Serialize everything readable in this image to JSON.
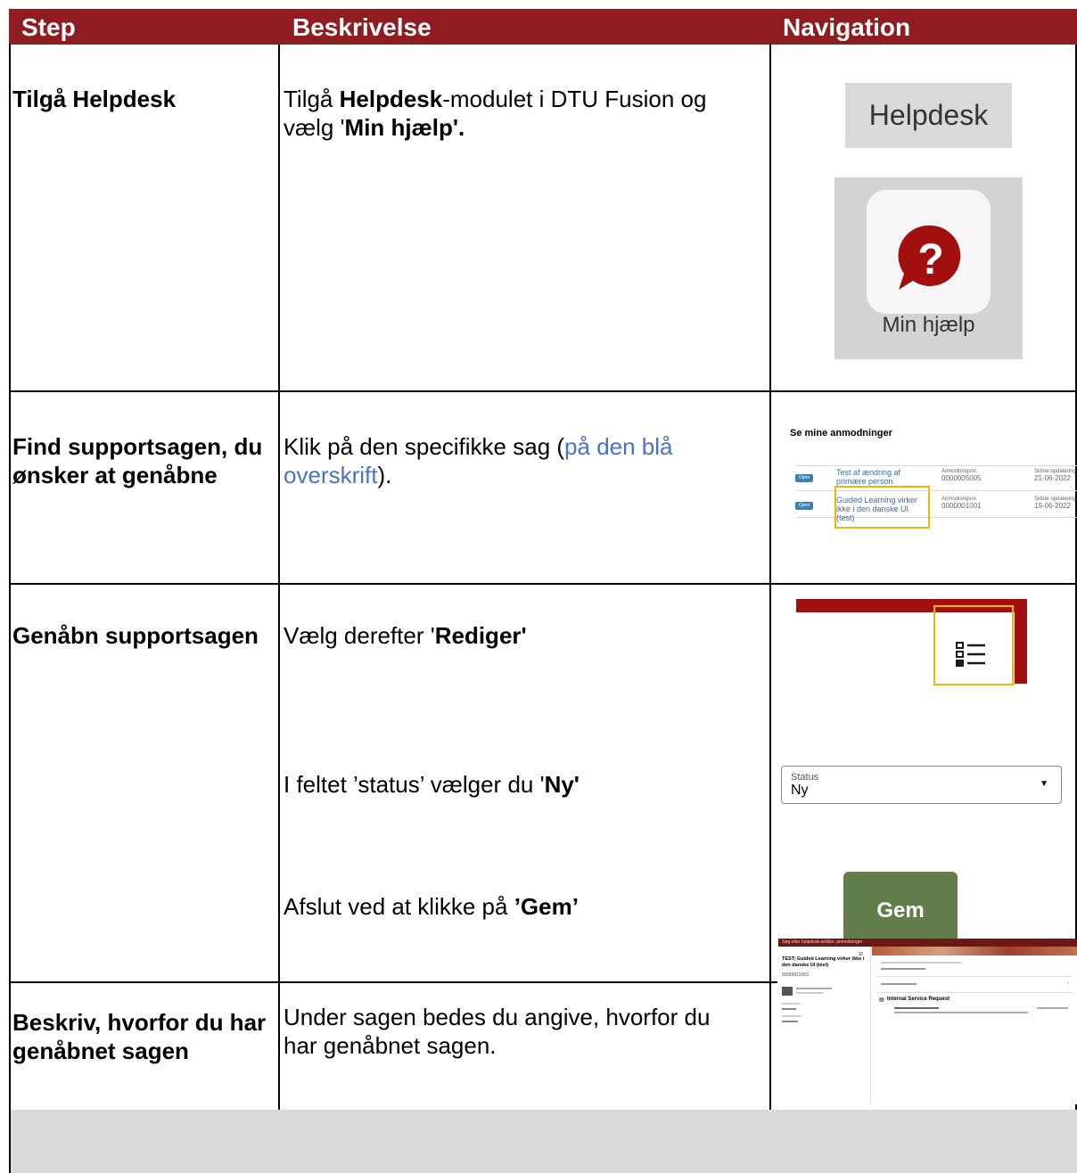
{
  "header": {
    "step": "Step",
    "description": "Beskrivelse",
    "navigation": "Navigation"
  },
  "colors": {
    "header_bg": "#8e1c20",
    "link": "#4a72c4",
    "gem_button": "#627e4b",
    "highlight": "#f2b705"
  },
  "rows": [
    {
      "step": "Tilgå Helpdesk",
      "desc": {
        "p1": "Tilgå ",
        "b1": "Helpdesk",
        "p2": "-modulet i DTU Fusion og vælg '",
        "b2": "Min hjælp'."
      },
      "nav": {
        "helpdesk_label": "Helpdesk",
        "min_hjaelp_label": "Min hjælp"
      }
    },
    {
      "step": "Find supportsagen, du ønsker at genåbne",
      "desc": {
        "p1": "Klik på den specifikke sag (",
        "link": "på den blå overskrift",
        "p2": ")."
      },
      "nav": {
        "title": "Se mine anmodninger",
        "items": [
          {
            "badge": "Open",
            "name": "Test af ændring af primære person",
            "num_label": "Anmodningsnr.",
            "num": "0000005005",
            "date_label": "Sidste opdatering",
            "date": "21-06-2022"
          },
          {
            "badge": "Open",
            "name": "Guided Learning virker ikke i den danske UI (test)",
            "num_label": "Anmodningsnr.",
            "num": "0000001001",
            "date_label": "Sidste opdatering",
            "date": "19-06-2022"
          }
        ]
      }
    },
    {
      "step": "Genåbn supportsagen",
      "desc1": {
        "p1": "Vælg derefter '",
        "b1": "Rediger'"
      },
      "desc2": {
        "p1": "I feltet ’status’ vælger du '",
        "b1": "Ny'"
      },
      "desc3": {
        "p1": "Afslut ved at klikke på ",
        "b1": "’Gem’"
      },
      "nav": {
        "status_label": "Status",
        "status_value": "Ny",
        "gem_label": "Gem"
      }
    },
    {
      "step": "Beskriv, hvorfor du har genåbnet sagen",
      "desc": "Under sagen bedes du angive, hvorfor du har genåbnet sagen.",
      "nav": {
        "search_placeholder": "Søg efter helpdesk-artikler, anmodninger",
        "case_title": "TEST; Guided Learning virker ikke i den danske UI (test)",
        "case_number": "0000001001",
        "section_title": "Internal Service Request"
      }
    }
  ]
}
